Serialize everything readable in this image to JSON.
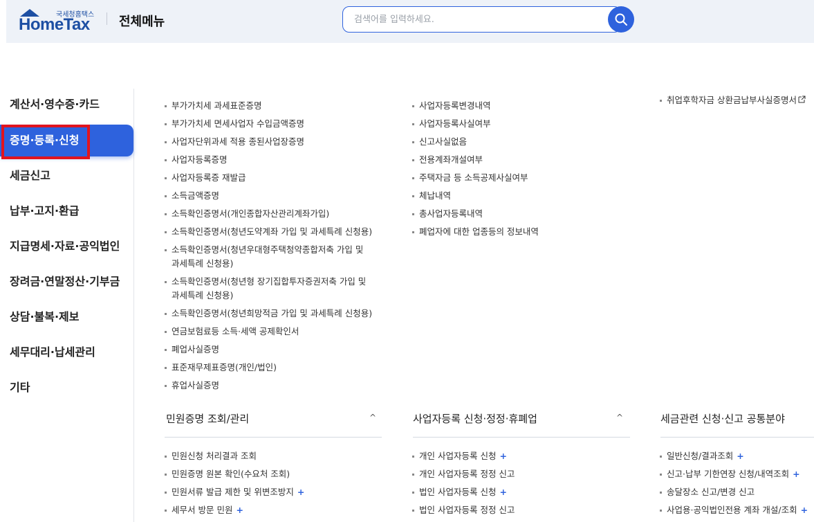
{
  "header": {
    "logo_small": "국세청홈택스",
    "logo_main": "HomeTax",
    "title": "전체메뉴",
    "search_placeholder": "검색어를 입력하세요."
  },
  "sidebar": {
    "items": [
      {
        "label": "계산서·영수증·카드"
      },
      {
        "label": "증명·등록·신청"
      },
      {
        "label": "세금신고"
      },
      {
        "label": "납부·고지·환급"
      },
      {
        "label": "지급명세·자료·공익법인"
      },
      {
        "label": "장려금·연말정산·기부금"
      },
      {
        "label": "상담·불복·제보"
      },
      {
        "label": "세무대리·납세관리"
      },
      {
        "label": "기타"
      }
    ]
  },
  "col1": {
    "items": [
      "부가가치세 과세표준증명",
      "부가가치세 면세사업자 수입금액증명",
      "사업자단위과세 적용 종된사업장증명",
      "사업자등록증명",
      "사업자등록증 재발급",
      "소득금액증명",
      "소득확인증명서(개인종합자산관리계좌가입)",
      "소득확인증명서(청년도약계좌 가입 및 과세특례 신청용)",
      "소득확인증명서(청년우대형주택청약종합저축 가입 및",
      "과세특례 신청용)",
      "소득확인증명서(청년형 장기집합투자증권저축 가입 및",
      "과세특례 신청용)",
      "소득확인증명서(청년희망적금 가입 및 과세특례 신청용)",
      "연금보험료등 소득·세액 공제확인서",
      "폐업사실증명",
      "표준재무제표증명(개인/법인)",
      "휴업사실증명"
    ]
  },
  "col2": {
    "items": [
      "사업자등록변경내역",
      "사업자등록사실여부",
      "신고사실없음",
      "전용계좌개설여부",
      "주택자금 등 소득공제사실여부",
      "체납내역",
      "총사업자등록내역",
      "폐업자에 대한 업종등의 정보내역"
    ]
  },
  "col3": {
    "items": [
      "취업후학자금 상환금납부사실증명서"
    ],
    "ext_icon": "external-link-icon"
  },
  "sections": [
    {
      "title": "민원증명 조회/관리",
      "items": [
        {
          "label": "민원신청 처리결과 조회",
          "plus": false
        },
        {
          "label": "민원증명 원본 확인(수요처 조회)",
          "plus": false
        },
        {
          "label": "민원서류 발급 제한 및 위변조방지",
          "plus": true
        },
        {
          "label": "세무서 방문 민원",
          "plus": true
        }
      ]
    },
    {
      "title": "사업자등록 신청·정정·휴폐업",
      "items": [
        {
          "label": "개인 사업자등록 신청",
          "plus": true
        },
        {
          "label": "개인 사업자등록 정정 신고",
          "plus": false
        },
        {
          "label": "법인 사업자등록 신청",
          "plus": true
        },
        {
          "label": "법인 사업자등록 정정 신고",
          "plus": false
        }
      ]
    },
    {
      "title": "세금관련 신청·신고 공통분야",
      "items": [
        {
          "label": "일반신청/결과조회",
          "plus": true
        },
        {
          "label": "신고·납부 기한연장 신청/내역조회",
          "plus": true
        },
        {
          "label": "송달장소 신고/변경 신고",
          "plus": false
        },
        {
          "label": "사업용·공익법인전용 계좌 개설/조회",
          "plus": true
        }
      ]
    }
  ],
  "plus_symbol": "+",
  "chevron_symbol": "^",
  "colors": {
    "accent": "#2e62dd",
    "highlight_box": "#e1141e"
  }
}
